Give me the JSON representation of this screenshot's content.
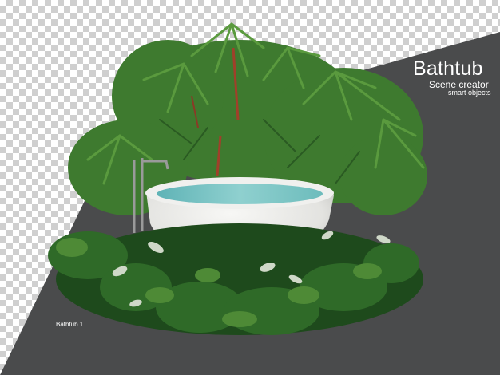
{
  "overlay": {
    "title": "Bathtub",
    "subtitle": "Scene creator",
    "tagline": "smart objects",
    "caption": "Bathtub 1"
  },
  "colors": {
    "backdrop": "#4a4b4c",
    "checker_light": "#ffffff",
    "checker_dark": "#cfcfcf",
    "tub": "#e9e9e7",
    "water": "#7ec4c4",
    "foliage_dark": "#1e4a1c",
    "foliage_mid": "#3e7a2f",
    "foliage_light": "#6fa64a",
    "palm_stem": "#a0402a"
  },
  "icons": [
    "faucet-icon"
  ]
}
